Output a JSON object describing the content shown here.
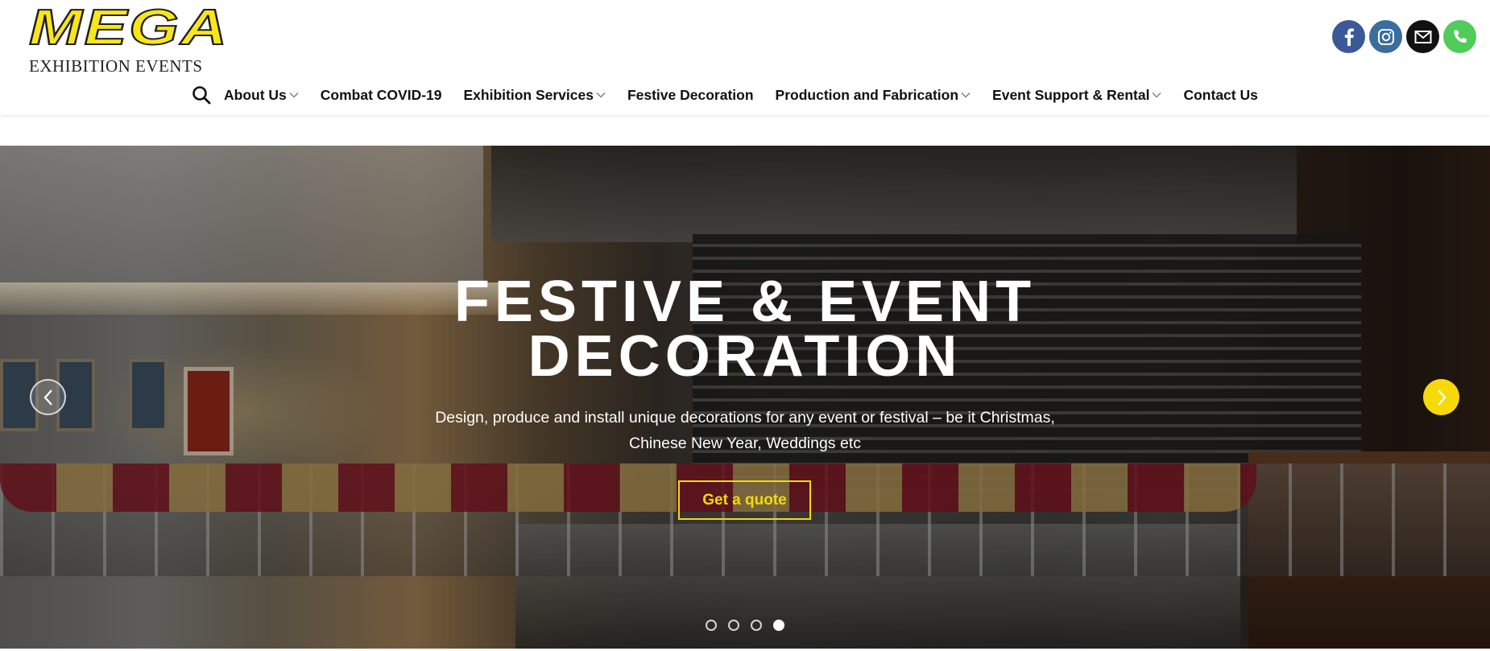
{
  "header": {
    "logo": {
      "wordmark": "MEGA",
      "subtitle": "EXHIBITION EVENTS"
    },
    "social": [
      {
        "name": "facebook-icon",
        "color": "#3b5998"
      },
      {
        "name": "instagram-icon",
        "color": "#3b6d9e"
      },
      {
        "name": "email-icon",
        "color": "#111111"
      },
      {
        "name": "phone-icon",
        "color": "#51cb5a"
      }
    ]
  },
  "nav": {
    "search_icon": "search-icon",
    "items": [
      {
        "label": "About Us",
        "has_dropdown": true
      },
      {
        "label": "Combat COVID-19",
        "has_dropdown": false
      },
      {
        "label": "Exhibition Services",
        "has_dropdown": true
      },
      {
        "label": "Festive Decoration",
        "has_dropdown": false
      },
      {
        "label": "Production and Fabrication",
        "has_dropdown": true
      },
      {
        "label": "Event Support & Rental",
        "has_dropdown": true
      },
      {
        "label": "Contact Us",
        "has_dropdown": false
      }
    ]
  },
  "hero": {
    "title_line1": "FESTIVE & EVENT",
    "title_line2": "DECORATION",
    "subtitle_line1": "Design, produce and install unique decorations for any event or festival – be it Christmas,",
    "subtitle_line2": "Chinese New Year, Weddings etc",
    "cta_label": "Get a quote",
    "accent_color": "#f5d90a",
    "slides_total": 4,
    "active_slide": 4
  }
}
